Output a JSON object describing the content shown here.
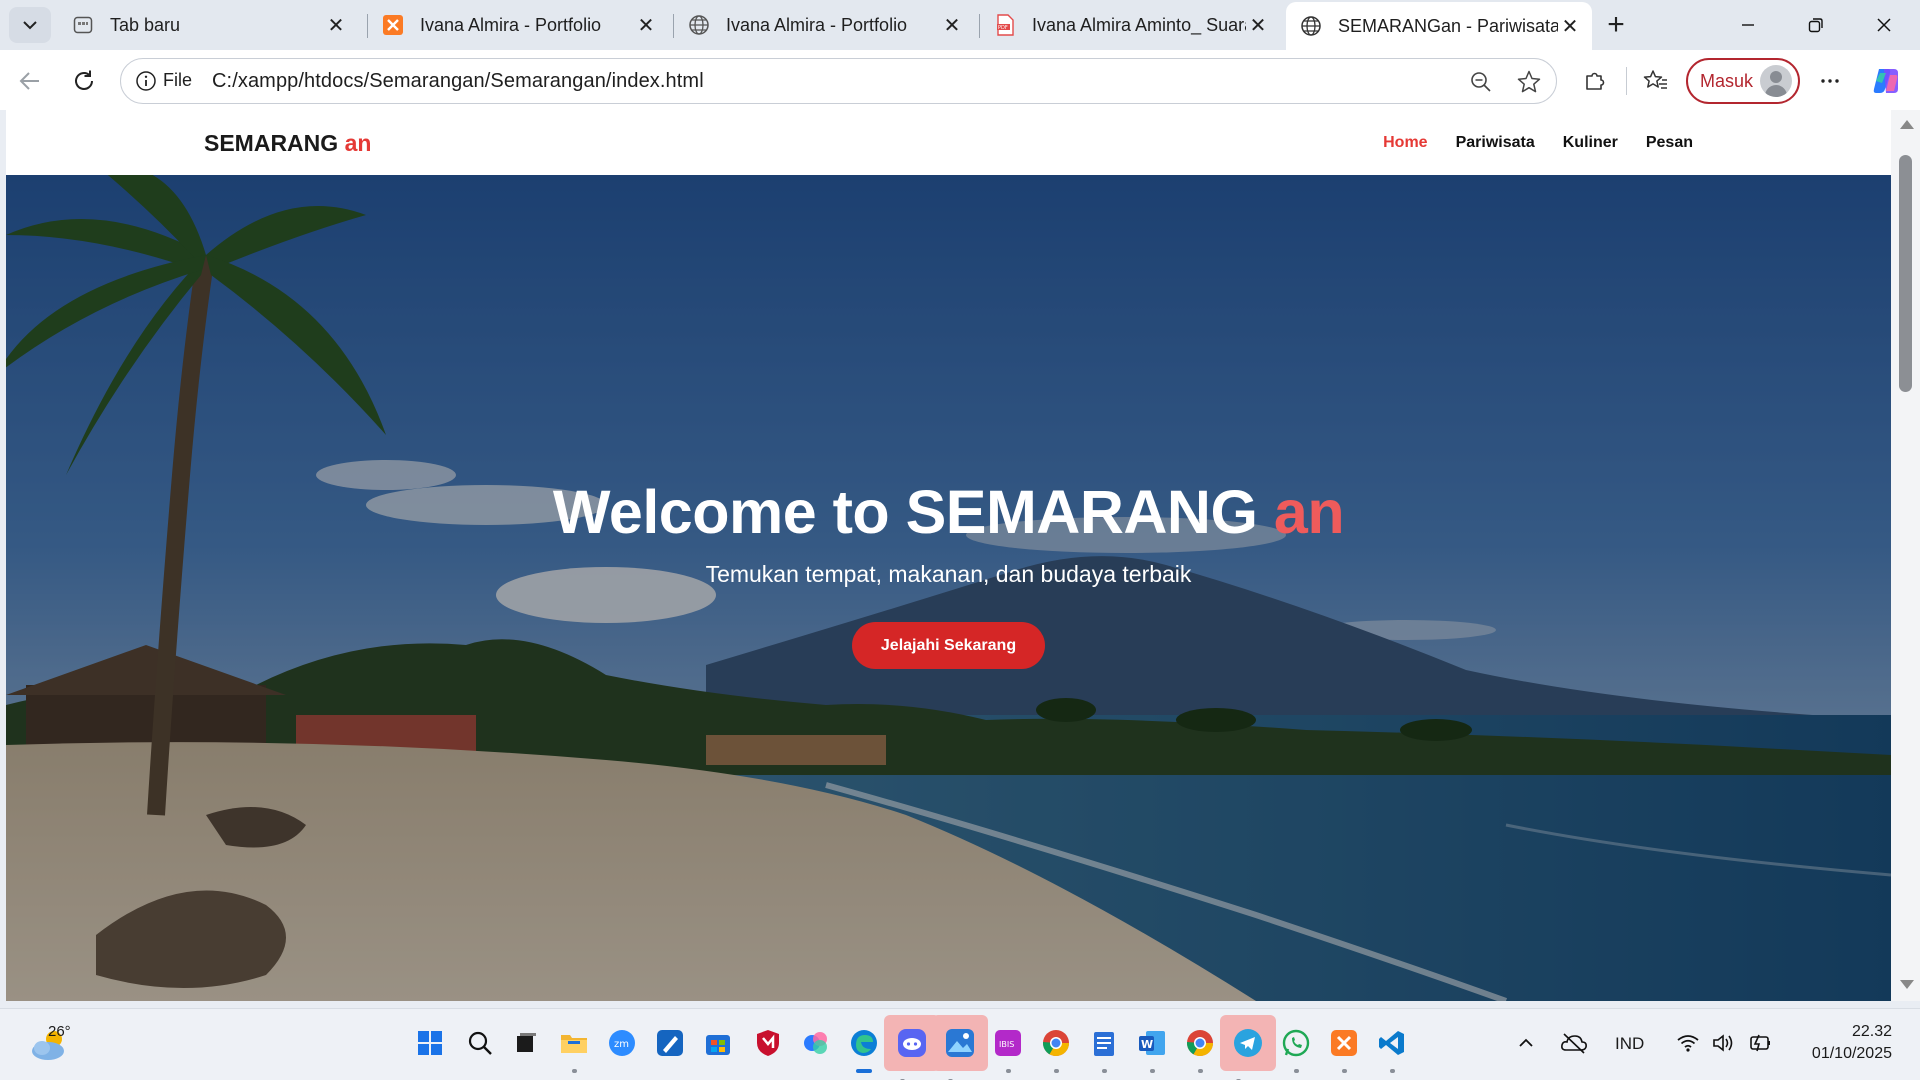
{
  "browser": {
    "tabs": [
      {
        "title": "Tab baru",
        "icon": "new-tab-page-icon",
        "active": false
      },
      {
        "title": "Ivana Almira - Portfolio",
        "icon": "xampp-icon",
        "active": false
      },
      {
        "title": "Ivana Almira - Portfolio",
        "icon": "globe-icon",
        "active": false
      },
      {
        "title": "Ivana Almira Aminto_ Suara",
        "icon": "pdf-icon",
        "active": false
      },
      {
        "title": "SEMARANGan - Pariwisata",
        "icon": "globe-icon",
        "active": true
      }
    ],
    "address": {
      "scheme_label": "File",
      "url": "C:/xampp/htdocs/Semarangan/Semarangan/index.html"
    },
    "profile_label": "Masuk",
    "accent": "#b3262f"
  },
  "site": {
    "logo_main": "SEMARANG",
    "logo_accent": "an",
    "nav": [
      "Home",
      "Pariwisata",
      "Kuliner",
      "Pesan"
    ],
    "active_nav": "Home",
    "hero": {
      "title_main": "Welcome to SEMARANG",
      "title_accent": "an",
      "subtitle": "Temukan tempat, makanan, dan budaya terbaik",
      "cta": "Jelajahi Sekarang"
    },
    "accent_color": "#e53935"
  },
  "taskbar": {
    "weather_temp": "26°",
    "language": "IND",
    "time": "22.32",
    "date": "01/10/2025"
  }
}
